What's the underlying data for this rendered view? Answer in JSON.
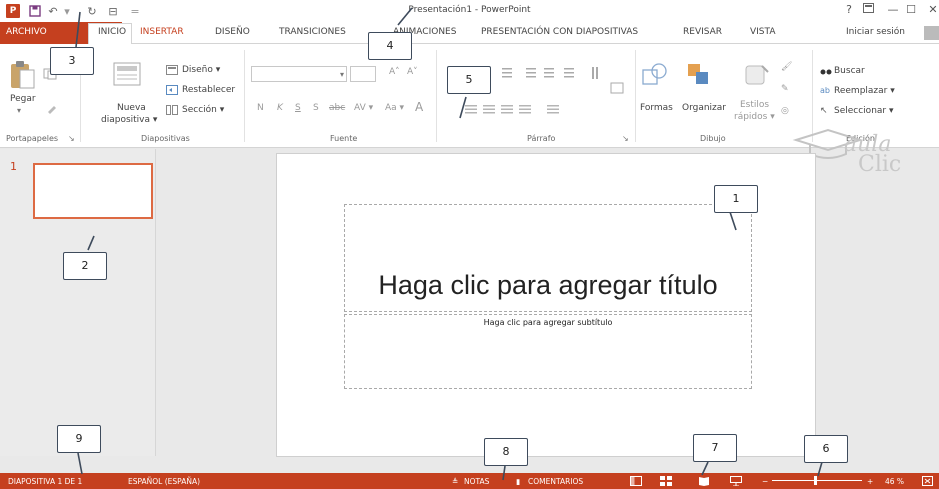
{
  "window": {
    "title": "Presentación1 - PowerPoint",
    "help": "?",
    "minimize": "—",
    "maximize": "☐",
    "close": "✕",
    "logo": "P"
  },
  "qat": {
    "save": "💾",
    "undo": "↶",
    "redo": "↻",
    "custom": "⊟",
    "more": "="
  },
  "tabs": {
    "archivo": "ARCHIVO",
    "inicio": "INICIO",
    "insertar": "INSERTAR",
    "diseno": "DISEÑO",
    "transiciones": "TRANSICIONES",
    "animaciones": "ANIMACIONES",
    "presentacion": "PRESENTACIÓN CON DIAPOSITIVAS",
    "revisar": "REVISAR",
    "vista": "VISTA",
    "signin": "Iniciar sesión"
  },
  "ribbon": {
    "portapapeles": {
      "pegar": "Pegar",
      "label": "Portapapeles"
    },
    "diapositivas": {
      "nueva": "Nueva",
      "diapositiva": "diapositiva ▾",
      "diseno": "Diseño ▾",
      "restablecer": "Restablecer",
      "seccion": "Sección ▾",
      "label": "Diapositivas"
    },
    "fuente": {
      "label": "Fuente",
      "bold": "N",
      "italic": "K",
      "underline": "S",
      "shadow": "S",
      "strike": "abc",
      "spacing": "AV ▾",
      "case": "Aa ▾",
      "grow": "A˄",
      "shrink": "A˅"
    },
    "parrafo": {
      "label": "Párrafo"
    },
    "dibujo": {
      "formas": "Formas",
      "organizar": "Organizar",
      "estilos": "Estilos",
      "rapidos": "rápidos ▾",
      "label": "Dibujo"
    },
    "edicion": {
      "buscar": "Buscar",
      "reemplazar": "Reemplazar ▾",
      "seleccionar": "Seleccionar ▾",
      "label": "Edición"
    }
  },
  "thumb": {
    "number": "1"
  },
  "slide": {
    "title": "Haga clic para agregar título",
    "subtitle": "Haga clic para agregar subtítulo"
  },
  "status": {
    "slide": "DIAPOSITIVA 1 DE 1",
    "lang": "ESPAÑOL (ESPAÑA)",
    "notas": "NOTAS",
    "comentarios": "COMENTARIOS",
    "zoom": "46 %",
    "minus": "−",
    "plus": "+"
  },
  "callouts": {
    "c1": "1",
    "c2": "2",
    "c3": "3",
    "c4": "4",
    "c5": "5",
    "c6": "6",
    "c7": "7",
    "c8": "8",
    "c9": "9"
  },
  "watermark": {
    "aula": "aula",
    "clic": "Clic"
  },
  "colors": {
    "accent": "#c5401f",
    "thumb_border": "#dd6a43"
  }
}
